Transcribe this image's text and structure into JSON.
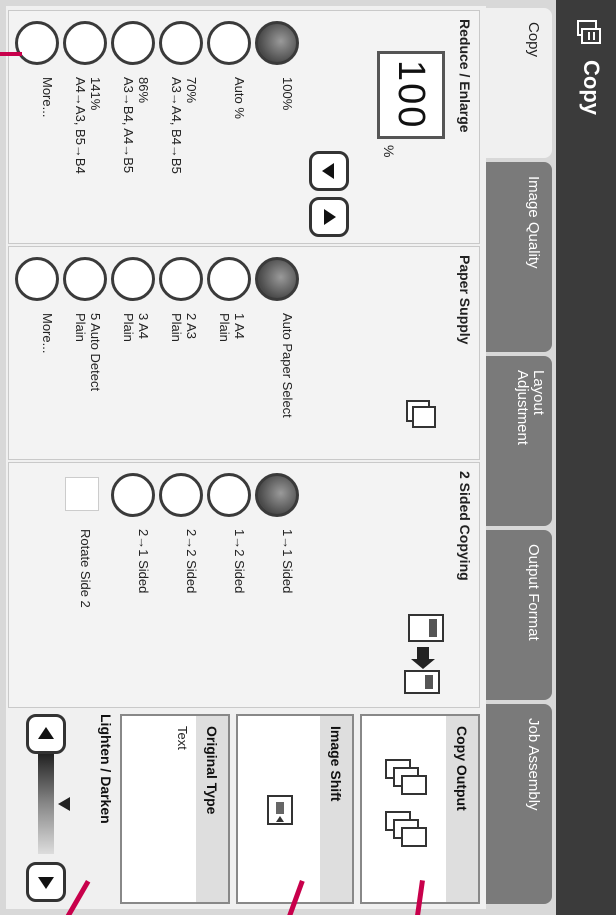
{
  "header": {
    "title": "Copy"
  },
  "tabs": [
    {
      "label": "Copy",
      "active": true
    },
    {
      "label": "Image Quality",
      "active": false
    },
    {
      "label": "Layout\nAdjustment",
      "active": false
    },
    {
      "label": "Output Format",
      "active": false
    },
    {
      "label": "Job Assembly",
      "active": false
    }
  ],
  "reduce_enlarge": {
    "title": "Reduce / Enlarge",
    "value": "100",
    "unit": "%",
    "options": [
      {
        "label": "100%",
        "selected": true
      },
      {
        "label": "Auto %",
        "selected": false
      },
      {
        "label": "70%\nA3→A4, B4→B5",
        "selected": false
      },
      {
        "label": "86%\nA3→B4, A4→B5",
        "selected": false
      },
      {
        "label": "141%\nA4→A3, B5→B4",
        "selected": false
      },
      {
        "label": "More...",
        "selected": false
      }
    ]
  },
  "paper_supply": {
    "title": "Paper Supply",
    "options": [
      {
        "label": "Auto Paper Select",
        "selected": true
      },
      {
        "label": "1 A4\nPlain",
        "selected": false
      },
      {
        "label": "2 A3\nPlain",
        "selected": false
      },
      {
        "label": "3 A4\nPlain",
        "selected": false
      },
      {
        "label": "5 Auto Detect\nPlain",
        "selected": false
      },
      {
        "label": "More...",
        "selected": false
      }
    ]
  },
  "two_sided": {
    "title": "2 Sided Copying",
    "options": [
      {
        "label": "1→1 Sided",
        "selected": true
      },
      {
        "label": "1→2 Sided",
        "selected": false
      },
      {
        "label": "2→2 Sided",
        "selected": false
      },
      {
        "label": "2→1 Sided",
        "selected": false
      }
    ],
    "rotate_label": "Rotate Side 2"
  },
  "right": {
    "copy_output": "Copy Output",
    "image_shift": "Image Shift",
    "original_type": "Original Type",
    "original_type_value": "Text",
    "lighten_darken": "Lighten / Darken"
  },
  "colors": {
    "header": "#3b3b3b",
    "callout": "#c8004b"
  },
  "icons": [
    "copy-logo-icon",
    "paper-tray-icon",
    "duplex-icon",
    "sorted-output-icon",
    "image-shift-icon"
  ]
}
